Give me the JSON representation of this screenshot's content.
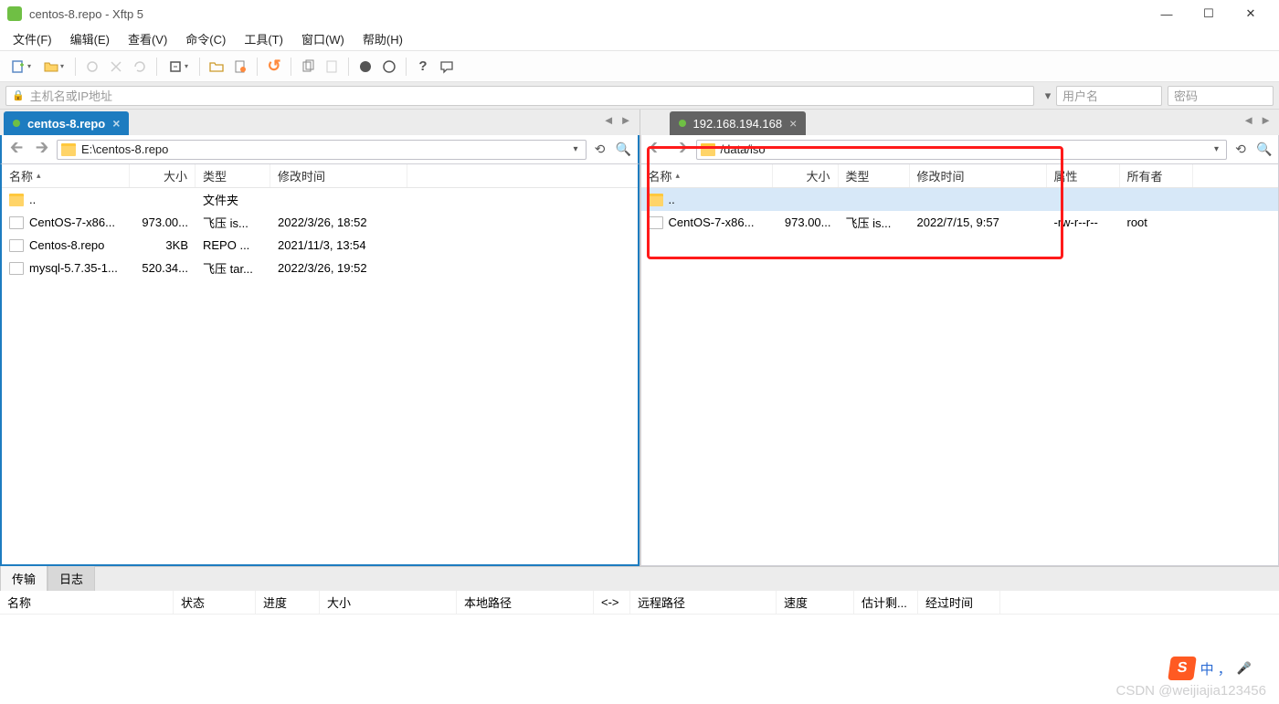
{
  "title": "centos-8.repo - Xftp 5",
  "menus": [
    "文件(F)",
    "编辑(E)",
    "查看(V)",
    "命令(C)",
    "工具(T)",
    "窗口(W)",
    "帮助(H)"
  ],
  "addressbar": {
    "host_placeholder": "主机名或IP地址",
    "user_placeholder": "用户名",
    "pass_placeholder": "密码"
  },
  "panes": {
    "left": {
      "tab": "centos-8.repo",
      "path": "E:\\centos-8.repo",
      "cols": {
        "name": "名称",
        "size": "大小",
        "type": "类型",
        "mtime": "修改时间"
      },
      "rows": [
        {
          "name": "..",
          "size": "",
          "type": "文件夹",
          "mtime": "",
          "icon": "folder"
        },
        {
          "name": "CentOS-7-x86...",
          "size": "973.00...",
          "type": "飞压 is...",
          "mtime": "2022/3/26, 18:52",
          "icon": "file"
        },
        {
          "name": "Centos-8.repo",
          "size": "3KB",
          "type": "REPO ...",
          "mtime": "2021/11/3, 13:54",
          "icon": "file"
        },
        {
          "name": "mysql-5.7.35-1...",
          "size": "520.34...",
          "type": "飞压 tar...",
          "mtime": "2022/3/26, 19:52",
          "icon": "file"
        }
      ]
    },
    "right": {
      "tab": "192.168.194.168",
      "path": "/data/iso",
      "cols": {
        "name": "名称",
        "size": "大小",
        "type": "类型",
        "mtime": "修改时间",
        "attr": "属性",
        "owner": "所有者"
      },
      "rows": [
        {
          "name": "..",
          "size": "",
          "type": "",
          "mtime": "",
          "attr": "",
          "owner": "",
          "icon": "folder",
          "selected": true
        },
        {
          "name": "CentOS-7-x86...",
          "size": "973.00...",
          "type": "飞压 is...",
          "mtime": "2022/7/15, 9:57",
          "attr": "-rw-r--r--",
          "owner": "root",
          "icon": "file"
        }
      ]
    }
  },
  "bottom": {
    "tabs": [
      "传输",
      "日志"
    ],
    "cols": [
      "名称",
      "状态",
      "进度",
      "大小",
      "本地路径",
      "<->",
      "远程路径",
      "速度",
      "估计剩...",
      "经过时间"
    ]
  },
  "watermark": "CSDN @weijiajia123456",
  "ime": {
    "letter": "S",
    "text": "中 ，"
  }
}
